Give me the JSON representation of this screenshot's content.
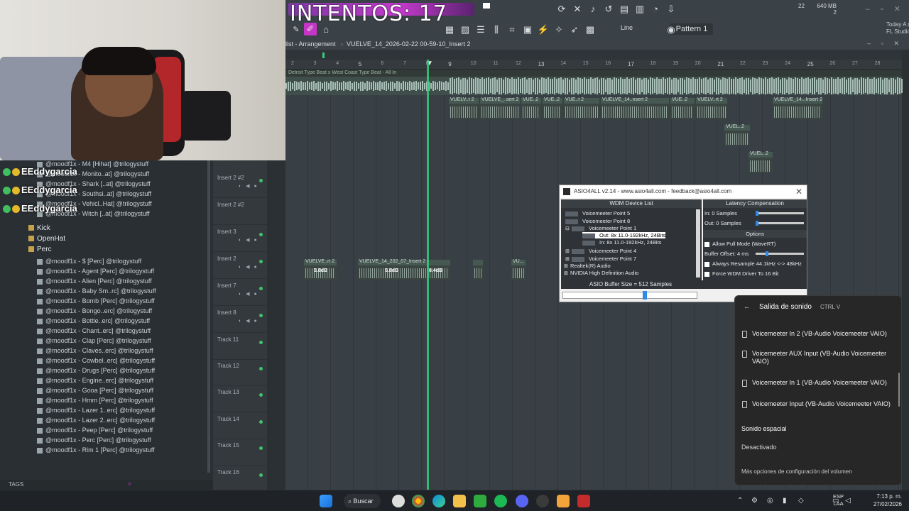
{
  "overlay": {
    "title": "INTENTOS: 17"
  },
  "toolbar": {
    "pattern": "Pattern 1",
    "line_mode": "Line",
    "news": "Today  A newer version of FL Studio is available!",
    "memory": "640 MB",
    "memory_sub": "2",
    "cpu": "22"
  },
  "arrangement": {
    "window_title": "list - Arrangement",
    "project": "VUELVE_14_2026-02-22 00-59-10_Insert 2",
    "top_clip_title": "Detroit Type Beat x West Coast Type Beat - All In",
    "ruler": [
      "2",
      "3",
      "4",
      "5",
      "6",
      "7",
      "8",
      "9",
      "10",
      "11",
      "12",
      "13",
      "14",
      "15",
      "16",
      "17",
      "18",
      "19",
      "20",
      "21",
      "22",
      "23",
      "24",
      "25",
      "26",
      "27",
      "28"
    ],
    "clips_row2": [
      "VUELV..t 2",
      "VUELVE_..sert 2",
      "VUE..2",
      "VUE..2",
      "VUE..t 2",
      "VUELVE_14..nsert 2",
      "VUE..2",
      "VUELV..rt 2",
      "VUELVE_14...Insert 2"
    ],
    "clips_row3": [
      "VUEL..2"
    ],
    "clips_row4": [
      "VUEL..2"
    ],
    "clips_insert2": [
      "VUELVE..rt 2",
      "VUELVE_14_202_07_Insert 2",
      "VUELV..rt 2",
      "VU..."
    ],
    "clip_gain": [
      "5.8dB",
      "5.8dB",
      "8.4dB"
    ]
  },
  "tracks": [
    {
      "label": "Insert 2 #2"
    },
    {
      "label": "Insert 2 #2"
    },
    {
      "label": "Insert 3"
    },
    {
      "label": "Insert 2"
    },
    {
      "label": "Insert 7"
    },
    {
      "label": "Insert 8"
    },
    {
      "label": "Track 11"
    },
    {
      "label": "Track 12"
    },
    {
      "label": "Track 13"
    },
    {
      "label": "Track 14"
    },
    {
      "label": "Track 15"
    },
    {
      "label": "Track 16"
    }
  ],
  "browser": {
    "items_top": [
      "@moodf1x - M4 [Hihat] @trilogystuff",
      "@moodf1x - Monito..at] @trilogystuff",
      "@moodf1x - Shark [..at] @trilogystuff",
      "@moodf1x - Southsi..at] @trilogystuff",
      "@moodf1x - Vehicl..Hat] @trilogystuff",
      "@moodf1x - Witch [..at] @trilogystuff"
    ],
    "folders": [
      "Kick",
      "OpenHat",
      "Perc"
    ],
    "items_perc": [
      "@moodf1x - $ [Perc] @trilogystuff",
      "@moodf1x - Agent [Perc] @trilogystuff",
      "@moodf1x - Alien [Perc] @trilogystuff",
      "@moodf1x - Baby Sm..rc] @trilogystuff",
      "@moodf1x - Bomb [Perc] @trilogystuff",
      "@moodf1x - Bongo..erc] @trilogystuff",
      "@moodf1x - Bottle..erc] @trilogystuff",
      "@moodf1x - Chant..erc] @trilogystuff",
      "@moodf1x - Clap [Perc] @trilogystuff",
      "@moodf1x - Claves..erc] @trilogystuff",
      "@moodf1x - Cowbel..erc] @trilogystuff",
      "@moodf1x - Drugs [Perc] @trilogystuff",
      "@moodf1x - Engine..erc] @trilogystuff",
      "@moodf1x - Gooa [Perc] @trilogystuff",
      "@moodf1x - Hmm [Perc] @trilogystuff",
      "@moodf1x - Lazer 1..erc] @trilogystuff",
      "@moodf1x - Lazer 2..erc] @trilogystuff",
      "@moodf1x - Peep [Perc] @trilogystuff",
      "@moodf1x - Perc [Perc] @trilogystuff",
      "@moodf1x - Rim 1 [Perc] @trilogystuff"
    ],
    "tags_label": "TAGS",
    "chat_names": [
      "EEddygarcia",
      "EEddygarcia",
      "EEddygarcia"
    ]
  },
  "asio": {
    "title": "ASIO4ALL v2.14 - www.asio4all.com - feedback@asio4all.com",
    "wdm_header": "WDM Device List",
    "devices": [
      "Voicemeeter Point 5",
      "Voicemeeter Point 8",
      "Voicemeeter Point 1",
      "Out:  8x 11.0-192kHz, 24Bits",
      "In:   8x 11.0-192kHz, 24Bits",
      "Voicemeeter Point 4",
      "Voicemeeter Point 7",
      "Realtek(R) Audio",
      "NVIDIA High Definition Audio"
    ],
    "latency_header": "Latency Compensation",
    "latency_in": "In:  0 Samples",
    "latency_out": "Out: 0 Samples",
    "options_header": "Options",
    "opt_pull": "Allow Pull Mode (WaveRT)",
    "buffer_offset": "Buffer Offset: 4 ms",
    "opt_resample": "Always Resample 44.1kHz <-> 48kHz",
    "opt_16bit": "Force WDM Driver To 16 Bit",
    "buffer_size": "ASIO Buffer Size = 512 Samples"
  },
  "sound_flyout": {
    "title": "Salida de sonido",
    "shortcut": "CTRL  V",
    "outputs": [
      "Voicemeeter In 2 (VB-Audio Voicemeeter VAIO)",
      "Voicemeeter AUX Input (VB-Audio Voicemeeter VAIO)",
      "Voicemeeter In 1 (VB-Audio Voicemeeter VAIO)",
      "Voicemeeter Input (VB-Audio Voicemeeter VAIO)"
    ],
    "spatial_title": "Sonido espacial",
    "spatial_value": "Desactivado",
    "more": "Más opciones de configuración del volumen"
  },
  "taskbar": {
    "search": "Buscar",
    "lang1": "ESP",
    "lang2": "LAA",
    "time": "7:13 p. m.",
    "date": "27/02/2026"
  }
}
